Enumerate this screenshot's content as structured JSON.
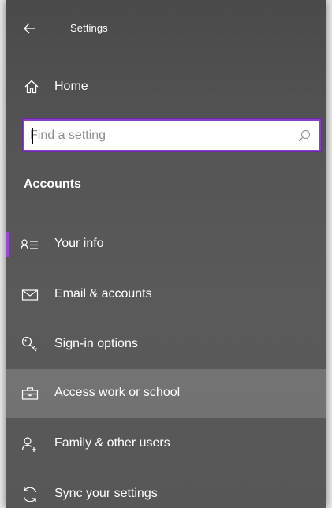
{
  "window": {
    "title": "Settings",
    "accent_color": "#8a3fc4"
  },
  "back_icon": "arrow-left-icon",
  "home": {
    "label": "Home",
    "icon": "home-icon"
  },
  "search": {
    "placeholder": "Find a setting",
    "value": "",
    "icon": "search-icon"
  },
  "section": {
    "title": "Accounts"
  },
  "nav": {
    "items": [
      {
        "label": "Your info",
        "icon": "person-info-icon",
        "active": true,
        "hovered": false
      },
      {
        "label": "Email & accounts",
        "icon": "mail-icon",
        "active": false,
        "hovered": false
      },
      {
        "label": "Sign-in options",
        "icon": "key-icon",
        "active": false,
        "hovered": false
      },
      {
        "label": "Access work or school",
        "icon": "briefcase-icon",
        "active": false,
        "hovered": true
      },
      {
        "label": "Family & other users",
        "icon": "add-person-icon",
        "active": false,
        "hovered": false
      },
      {
        "label": "Sync your settings",
        "icon": "sync-icon",
        "active": false,
        "hovered": false
      }
    ]
  }
}
